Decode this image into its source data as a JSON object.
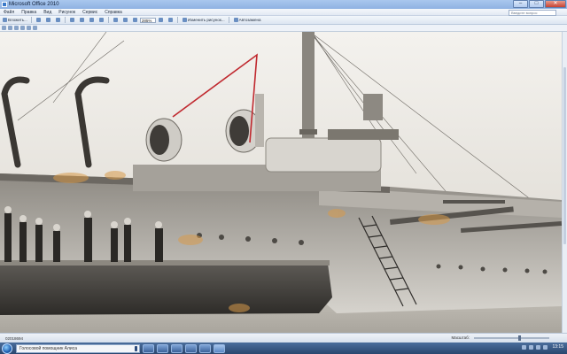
{
  "window": {
    "title": "Microsoft Office 2010",
    "controls": {
      "minimize": "–",
      "maximize": "□",
      "close": "✕"
    }
  },
  "menu": {
    "items": [
      "Файл",
      "Правка",
      "Вид",
      "Рисунок",
      "Сервис",
      "Справка"
    ],
    "help_placeholder": "Введите вопрос"
  },
  "toolbar": {
    "open_label": "Вложить...",
    "zoom": "285%",
    "edit_picture_label": "Изменить рисунок...",
    "autofit_label": "Автозамена"
  },
  "status": {
    "left_text": "02018694",
    "zoom_label": "Масштаб:"
  },
  "taskbar": {
    "assistant_label": "Голосовой помощник Алиса",
    "clock": "13:15"
  },
  "colors": {
    "annotation_line": "#c0292f",
    "accent": "#3a79c9"
  },
  "icons": [
    "start-orb-icon",
    "microphone-icon",
    "folder-icon",
    "browser-icon",
    "media-icon",
    "office-icon"
  ]
}
